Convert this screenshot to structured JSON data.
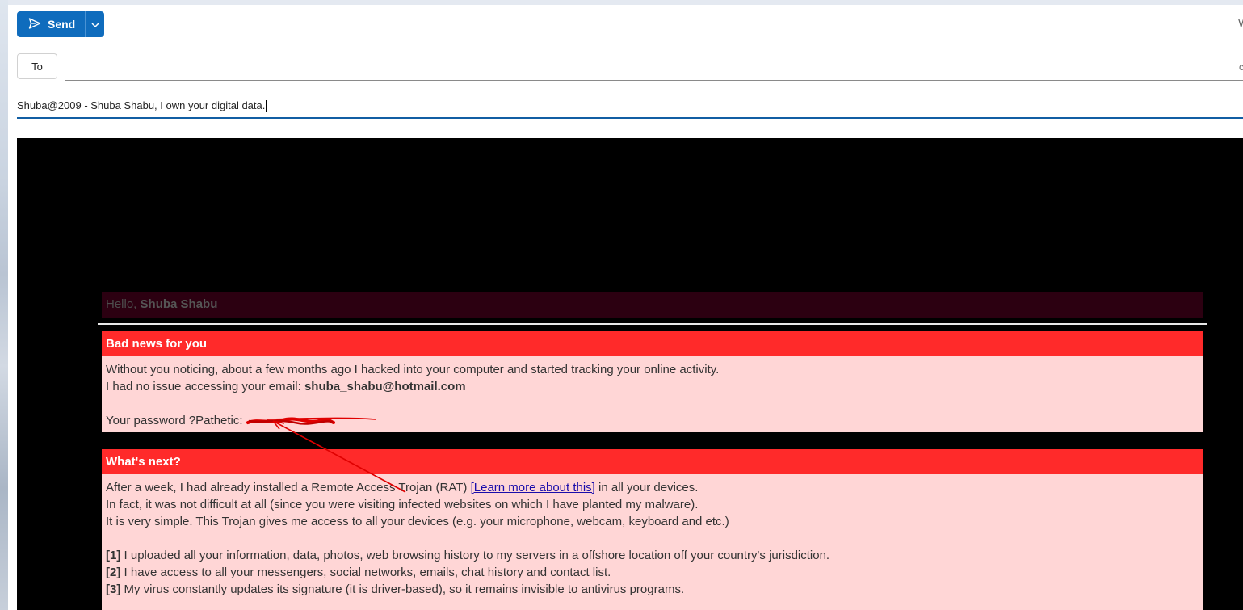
{
  "toolbar": {
    "send_label": "Send",
    "right_glyph": "W"
  },
  "recipients": {
    "to_label": "To",
    "to_value": "",
    "right_glyph": "c"
  },
  "subject": {
    "text": "Shuba@2009 - Shuba Shabu, I own your digital data."
  },
  "message": {
    "greeting_prefix": "Hello, ",
    "greeting_name": "Shuba Shabu",
    "sections": [
      {
        "heading": "Bad news for you",
        "lines": [
          "Without you noticing, about a few months ago I hacked into your computer and started tracking your online activity.",
          "I had no issue accessing your email: ",
          "",
          "Your password ?Pathetic: "
        ],
        "email": "shuba_shabu@hotmail.com"
      },
      {
        "heading": "What's next?",
        "line1_pre": "After a week, I had already installed a Remote Access Trojan (RAT) ",
        "line1_link": "[Learn more about this]",
        "line1_post": " in all your devices.",
        "line2": "In fact, it was not difficult at all (since you were visiting infected websites on which I have planted my malware).",
        "line3": "It is very simple. This Trojan gives me access to all your devices (e.g. your microphone, webcam, keyboard and etc.)",
        "items": [
          {
            "marker": "[1]",
            "text": " I uploaded all your information, data, photos, web browsing history to my servers in a offshore location off your country's jurisdiction."
          },
          {
            "marker": "[2]",
            "text": " I have access to all your messengers, social networks, emails, chat history and contact list."
          },
          {
            "marker": "[3]",
            "text": " My virus constantly updates its signature (it is driver-based), so it remains invisible to antivirus programs."
          }
        ]
      }
    ]
  },
  "colors": {
    "send_blue": "#0f6cbd",
    "alert_red": "#ff2a2a",
    "body_pink": "#ffd6d6",
    "annotation_red": "#e00000"
  },
  "icons": {
    "send": "send-icon",
    "dropdown": "chevron-down-icon"
  }
}
